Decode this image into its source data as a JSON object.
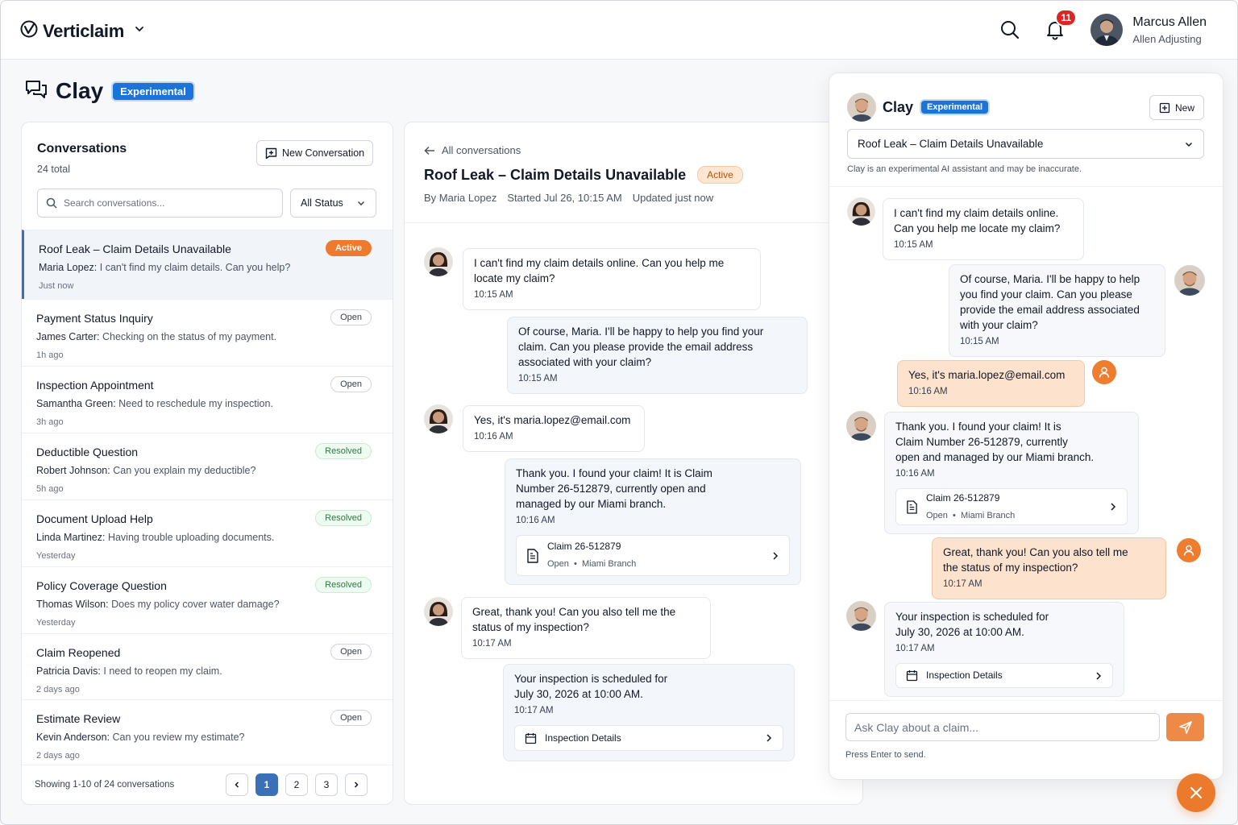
{
  "app": {
    "brand": "Verticlaim"
  },
  "header": {
    "notifications": "11",
    "user_name": "Marcus Allen",
    "user_org": "Allen Adjusting"
  },
  "page": {
    "title": "Clay",
    "badge": "Experimental"
  },
  "list": {
    "title": "Conversations",
    "total": "24 total",
    "new_button": "New Conversation",
    "search_placeholder": "Search conversations...",
    "status_filter": "All Status",
    "items": [
      {
        "title": "Roof Leak – Claim Details Unavailable",
        "author": "Maria Lopez:",
        "preview": "I can't find my claim details. Can you help?",
        "time": "Just now",
        "status": "Active"
      },
      {
        "title": "Payment Status Inquiry",
        "author": "James Carter:",
        "preview": "Checking on the status of my payment.",
        "time": "1h ago",
        "status": "Open"
      },
      {
        "title": "Inspection Appointment",
        "author": "Samantha Green:",
        "preview": "Need to reschedule my inspection.",
        "time": "3h ago",
        "status": "Open"
      },
      {
        "title": "Deductible Question",
        "author": "Robert Johnson:",
        "preview": "Can you explain my deductible?",
        "time": "5h ago",
        "status": "Resolved"
      },
      {
        "title": "Document Upload Help",
        "author": "Linda Martinez:",
        "preview": "Having trouble uploading documents.",
        "time": "Yesterday",
        "status": "Resolved"
      },
      {
        "title": "Policy Coverage Question",
        "author": "Thomas Wilson:",
        "preview": "Does my policy cover water damage?",
        "time": "Yesterday",
        "status": "Resolved"
      },
      {
        "title": "Claim Reopened",
        "author": "Patricia Davis:",
        "preview": "I need to reopen my claim.",
        "time": "2 days ago",
        "status": "Open"
      },
      {
        "title": "Estimate Review",
        "author": "Kevin Anderson:",
        "preview": "Can you review my estimate?",
        "time": "2 days ago",
        "status": "Open"
      }
    ],
    "showing": "Showing 1-10 of 24 conversations",
    "pages": [
      "1",
      "2",
      "3"
    ]
  },
  "conversation": {
    "back": "All conversations",
    "title": "Roof Leak – Claim Details Unavailable",
    "status": "Active",
    "by": "By Maria Lopez",
    "started": "Started Jul 26, 10:15 AM",
    "updated": "Updated just now",
    "messages": [
      {
        "l1": "I can't find my claim details online. Can you help me",
        "l2": "locate my claim?",
        "time": "10:15 AM"
      },
      {
        "l1": "Of course, Maria. I'll be happy to help you find your",
        "l2": "claim. Can you please provide the email address",
        "l3": "associated with your claim?",
        "time": "10:15 AM"
      },
      {
        "l1": "Yes, it's maria.lopez@email.com",
        "time": "10:16 AM"
      },
      {
        "l1": "Thank you. I found your claim! It is Claim",
        "l2": "Number 26-512879, currently open and",
        "l3": "managed by our Miami branch.",
        "time": "10:16 AM",
        "card_title": "Claim 26-512879",
        "card_status": "Open",
        "card_branch": "Miami Branch"
      },
      {
        "l1": "Great, thank you! Can you also tell me the",
        "l2": "status of my inspection?",
        "time": "10:17 AM"
      },
      {
        "l1": "Your inspection is scheduled for",
        "l2": "July 30, 2026 at 10:00 AM.",
        "time": "10:17 AM",
        "card_title": "Inspection Details"
      }
    ]
  },
  "clay": {
    "name": "Clay",
    "badge": "Experimental",
    "new_button": "New",
    "selected_conversation": "Roof Leak – Claim Details Unavailable",
    "disclaimer": "Clay is an experimental AI assistant and may be inaccurate.",
    "messages": [
      {
        "l1": "I can't find my claim details online.",
        "l2": "Can you help me locate my claim?",
        "time": "10:15 AM"
      },
      {
        "l1": "Of course, Maria. I'll be happy to help",
        "l2": "you find your claim. Can you please",
        "l3": "provide the email address associated",
        "l4": "with your claim?",
        "time": "10:15 AM"
      },
      {
        "l1": "Yes, it's maria.lopez@email.com",
        "time": "10:16 AM"
      },
      {
        "l1": "Thank you. I found your claim! It is",
        "l2": "Claim Number 26-512879, currently",
        "l3": "open and managed by our Miami branch.",
        "time": "10:16 AM",
        "card_title": "Claim 26-512879",
        "card_status": "Open",
        "card_branch": "Miami Branch"
      },
      {
        "l1": "Great, thank you! Can you also tell me",
        "l2": "the status of my inspection?",
        "time": "10:17 AM"
      },
      {
        "l1": "Your inspection is scheduled for",
        "l2": "July 30, 2026 at 10:00 AM.",
        "time": "10:17 AM",
        "card_title": "Inspection Details"
      }
    ],
    "input_placeholder": "Ask Clay about a claim...",
    "hint": "Press Enter to send."
  },
  "colors": {
    "accent": "#ec7a2c",
    "primary": "#1d74d8",
    "selected": "#3b6fb6"
  },
  "icons": [
    "verticlaim-logo-icon",
    "chevron-down-icon",
    "search-icon",
    "bell-icon",
    "chat-bubbles-icon",
    "plus-square-icon",
    "arrow-left-icon",
    "document-icon",
    "calendar-icon",
    "chevron-right-icon",
    "chevron-left-icon",
    "send-icon",
    "user-icon",
    "close-icon"
  ]
}
